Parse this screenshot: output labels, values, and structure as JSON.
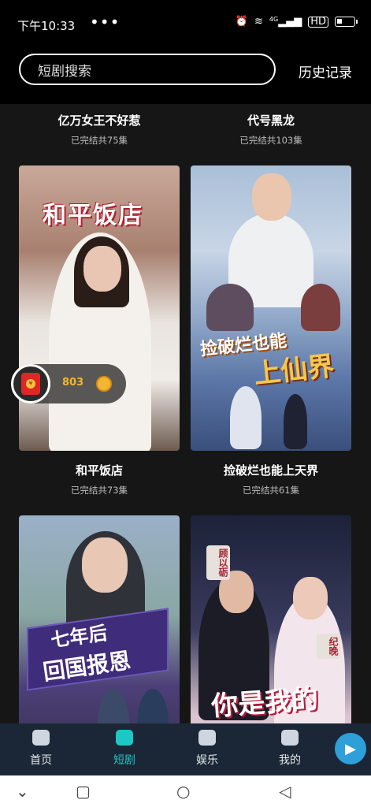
{
  "status_bar": {
    "time": "下午10:33",
    "dots": "•••",
    "network": "4G",
    "hd": "HD"
  },
  "header": {
    "search_placeholder": "短剧搜索",
    "history_label": "历史记录"
  },
  "top_row": [
    {
      "title": "亿万女王不好惹",
      "status": "已完结共75集"
    },
    {
      "title": "代号黑龙",
      "status": "已完结共103集"
    }
  ],
  "cards": [
    {
      "title": "和平饭店",
      "status": "已完结共73集",
      "poster_text": "和平饭店"
    },
    {
      "title": "捡破烂也能上天界",
      "status": "已完结共61集",
      "poster_text_1": "捡破烂也能",
      "poster_text_2": "上仙界"
    },
    {
      "poster_text_1": "七年后",
      "poster_text_2": "回国报恩"
    },
    {
      "poster_text": "你是我的",
      "tag_1": "顾以砺",
      "tag_2": "纪晚"
    }
  ],
  "reward": {
    "coins": "803",
    "icon": "red-packet-icon"
  },
  "bottom_nav": [
    {
      "label": "首页",
      "icon": "home-icon"
    },
    {
      "label": "短剧",
      "icon": "clapperboard-icon"
    },
    {
      "label": "娱乐",
      "icon": "bookmark-icon"
    },
    {
      "label": "我的",
      "icon": "robot-icon"
    }
  ],
  "colors": {
    "accent": "#1ec7c7",
    "coin": "#f2b534",
    "background": "#161616"
  }
}
